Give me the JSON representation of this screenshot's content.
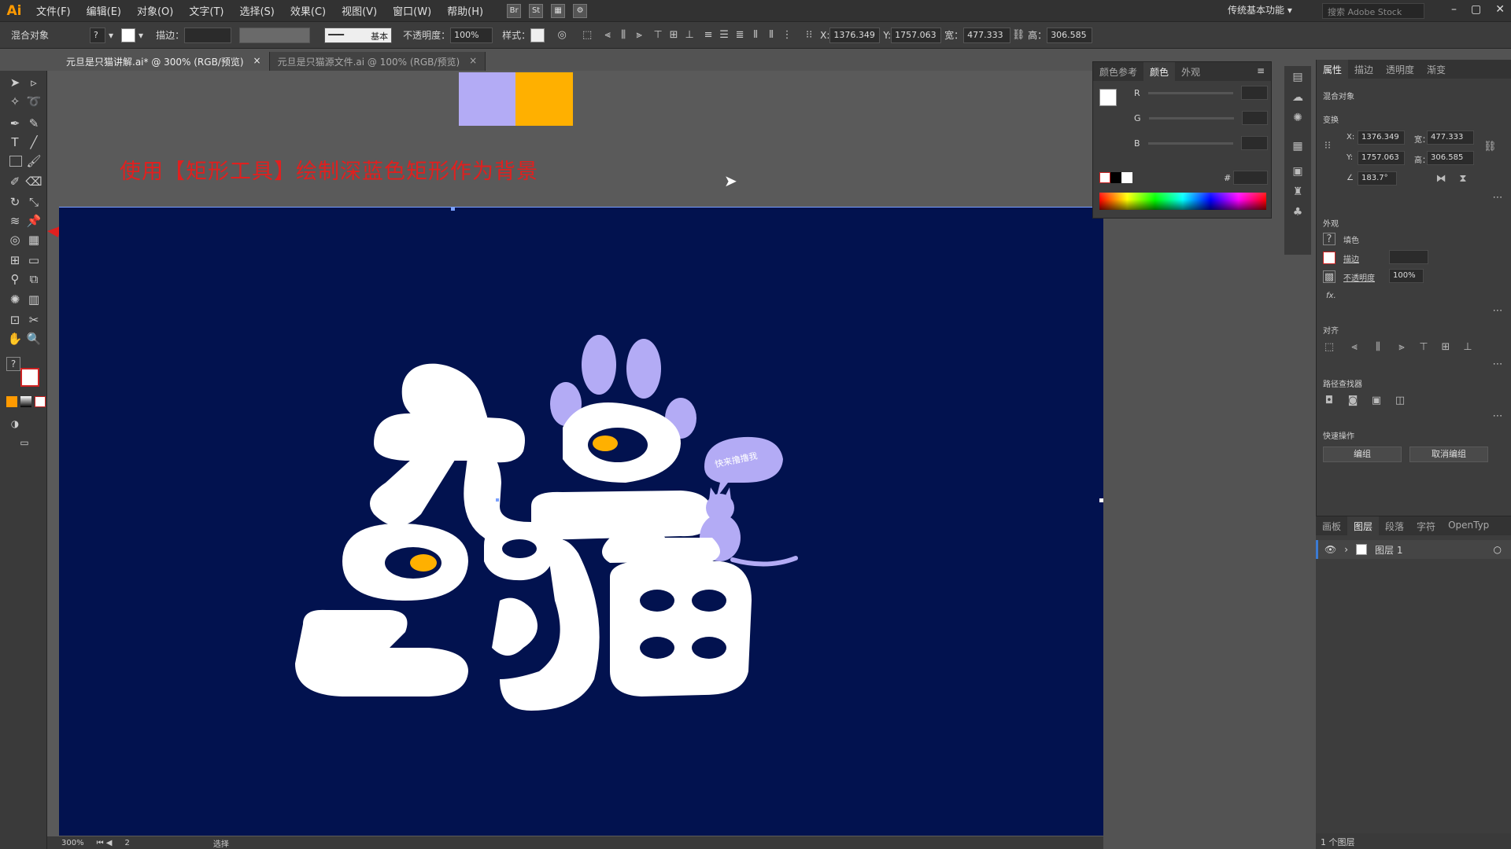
{
  "app": {
    "logo": "Ai"
  },
  "menu": [
    "文件(F)",
    "编辑(E)",
    "对象(O)",
    "文字(T)",
    "选择(S)",
    "效果(C)",
    "视图(V)",
    "窗口(W)",
    "帮助(H)"
  ],
  "menu_icons": [
    "Br",
    "St"
  ],
  "workspace": "传统基本功能",
  "search_placeholder": "搜索 Adobe Stock",
  "control": {
    "selection_label": "混合对象",
    "stroke_label": "描边：",
    "stroke_style": "基本",
    "opacity_label": "不透明度：",
    "opacity": "100%",
    "style_label": "样式：",
    "x_label": "X:",
    "x": "1376.349",
    "y_label": "Y:",
    "y": "1757.063",
    "w_label": "宽：",
    "w": "477.333",
    "h_label": "高：",
    "h": "306.585"
  },
  "tabs": [
    {
      "label": "元旦是只猫讲解.ai* @ 300% (RGB/预览)",
      "close": "×"
    },
    {
      "label": "元旦是只猫源文件.ai @ 100% (RGB/预览)",
      "close": "×"
    }
  ],
  "annotation": "使用【矩形工具】绘制深蓝色矩形作为背景",
  "artwork": {
    "line1": "元旦",
    "line2": "是只猫",
    "bubble": "快来撸撸我"
  },
  "colors": {
    "artboard": "#02124f",
    "lavender": "#b3abf5",
    "orange": "#ffb000",
    "annotation": "#e0201f"
  },
  "color_panel": {
    "tabs": [
      "颜色参考",
      "颜色",
      "外观"
    ],
    "channels": [
      "R",
      "G",
      "B"
    ],
    "hex_label": "#"
  },
  "properties": {
    "tabs": [
      "属性",
      "描边",
      "透明度",
      "渐变"
    ],
    "object_type": "混合对象",
    "transform_title": "变换",
    "x_label": "X:",
    "x": "1376.349",
    "y_label": "Y:",
    "y": "1757.063",
    "w_label": "宽：",
    "w": "477.333",
    "h_label": "高：",
    "h": "306.585",
    "angle": "183.7°",
    "appearance_title": "外观",
    "fill_label": "填色",
    "stroke_label": "描边",
    "opacity_label": "不透明度",
    "opacity": "100%",
    "fx_label": "fx.",
    "align_title": "对齐",
    "pathfinder_title": "路径查找器",
    "quick_actions_title": "快速操作",
    "edit_button": "编组",
    "cancel_button": "取消编组"
  },
  "layers": {
    "tabs": [
      "画板",
      "图层",
      "段落",
      "字符",
      "OpenTyp"
    ],
    "layer_name": "图层 1",
    "count": "1 个图层"
  },
  "status": {
    "zoom": "300%",
    "artboard": "2",
    "mode": "选择"
  }
}
